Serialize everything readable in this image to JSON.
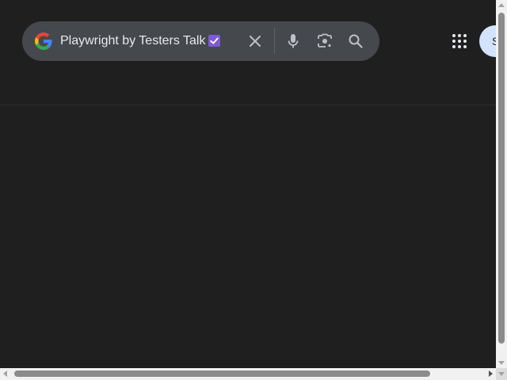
{
  "search": {
    "query": "Playwright by Testers Talk",
    "logo_icon": "google-g-icon",
    "clear_icon": "close-icon",
    "voice_icon": "microphone-icon",
    "lens_icon": "camera-lens-icon",
    "search_icon": "search-icon"
  },
  "header": {
    "apps_icon": "apps-grid-icon",
    "avatar_letter": "S"
  },
  "colors": {
    "page_bg": "#1f1f1f",
    "searchbox_bg": "#45484d",
    "text": "#e8eaed",
    "icon": "#bdc1c6",
    "avatar_bg": "#d3e3fd",
    "emoji_check": "#7e5bd2"
  }
}
